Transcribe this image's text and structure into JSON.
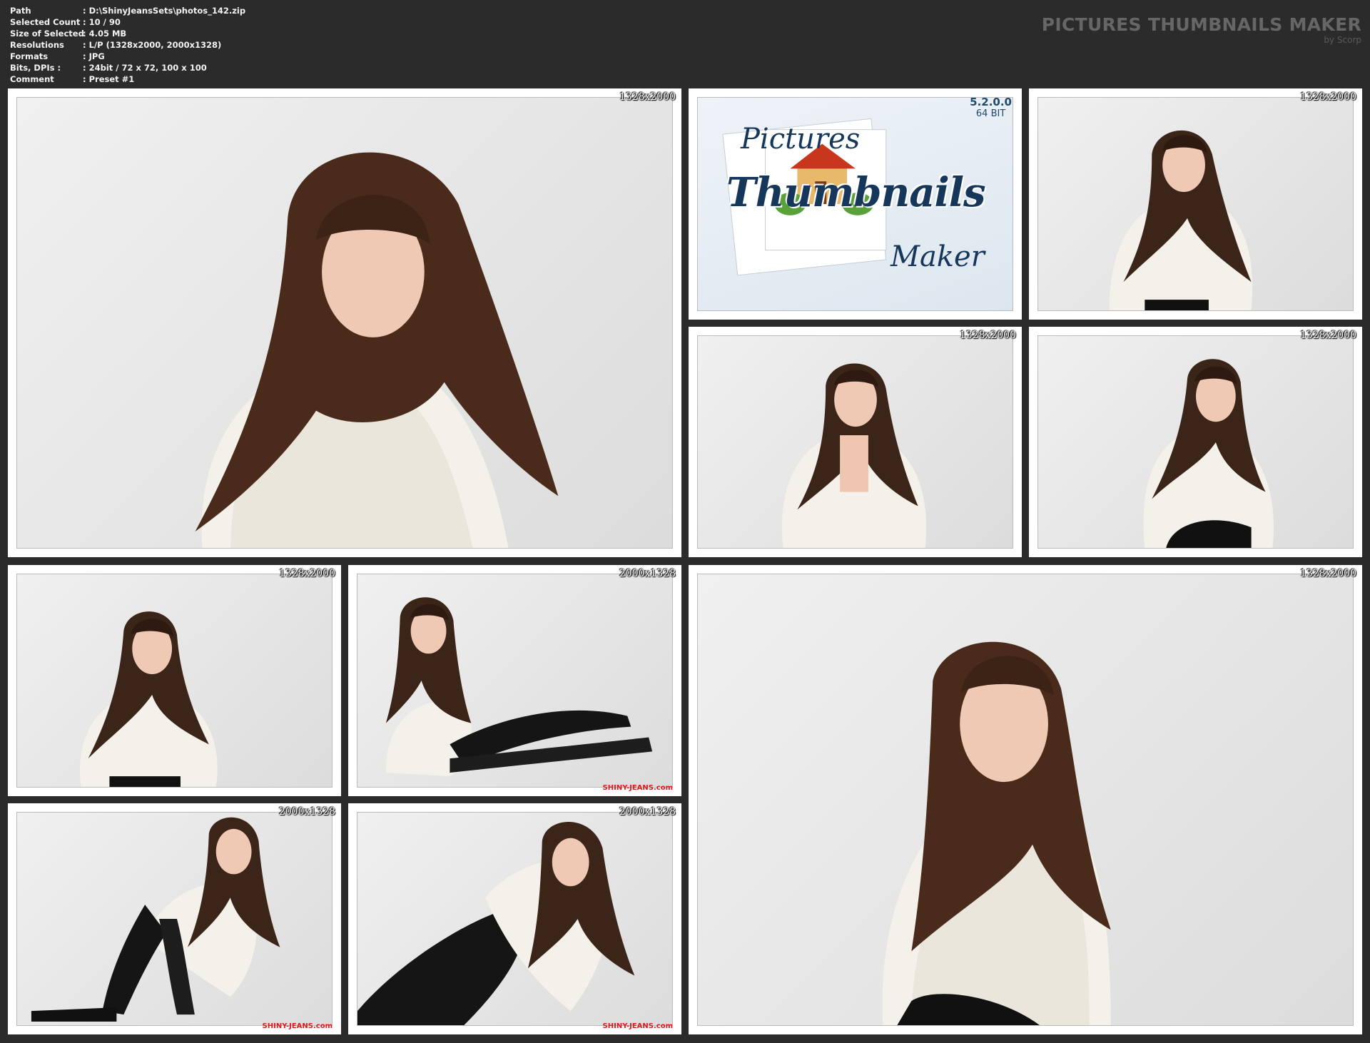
{
  "info": [
    {
      "label": "Path",
      "value": ": D:\\ShinyJeansSets\\photos_142.zip"
    },
    {
      "label": "Selected Count",
      "value": ": 10 / 90"
    },
    {
      "label": "Size of Selected",
      "value": ": 4.05 MB"
    },
    {
      "label": "Resolutions",
      "value": ": L/P (1328x2000, 2000x1328)"
    },
    {
      "label": "Formats",
      "value": ": JPG"
    },
    {
      "label": "Bits, DPIs :",
      "value": ": 24bit / 72 x 72, 100 x 100"
    },
    {
      "label": "Comment",
      "value": ": Preset #1"
    }
  ],
  "brand": {
    "title": "PICTURES THUMBNAILS MAKER",
    "by": "by Scorp"
  },
  "logo": {
    "version": "5.2.0.0",
    "bits": "64 BIT",
    "word1": "Pictures",
    "word2": "Thumbnails",
    "word3": "Maker"
  },
  "thumbs": [
    {
      "res": "1328x2000"
    },
    {
      "res": "1328x2000"
    },
    {
      "res": "1328x2000"
    },
    {
      "res": "1328x2000"
    },
    {
      "res": "1328x2000"
    },
    {
      "res": "2000x1328",
      "wm": "SHINY-JEANS.com"
    },
    {
      "res": "2000x1328",
      "wm": "SHINY-JEANS.com"
    },
    {
      "res": "2000x1328",
      "wm": "SHINY-JEANS.com"
    },
    {
      "res": "1328x2000"
    }
  ]
}
